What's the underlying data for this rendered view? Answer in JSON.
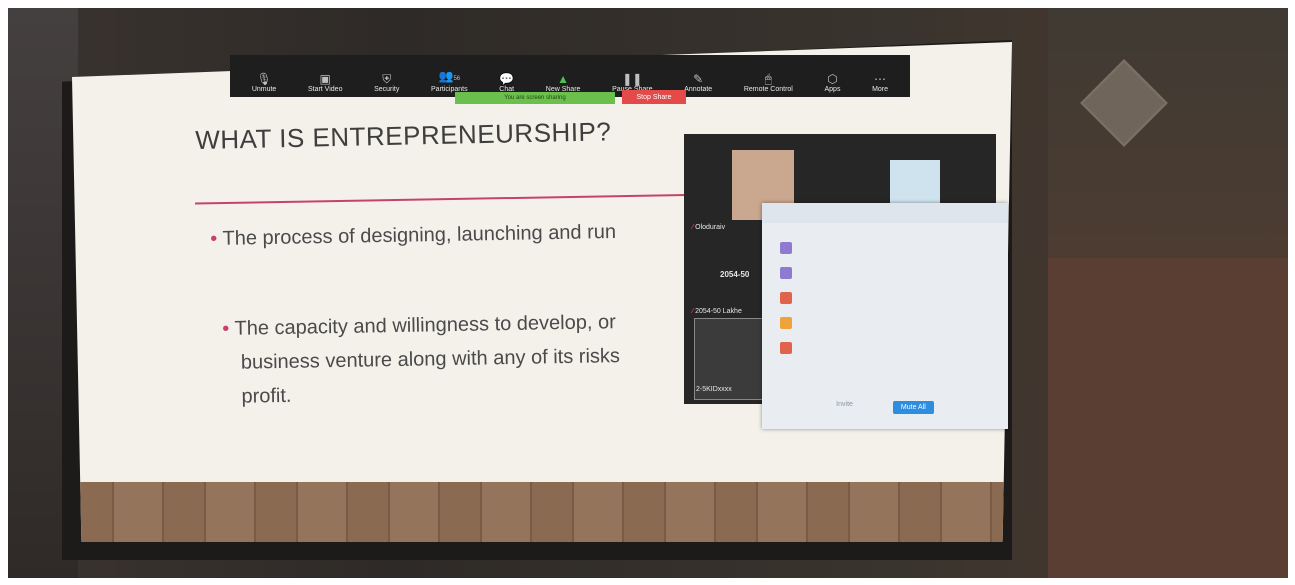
{
  "toolbar": {
    "items": [
      {
        "label": "Unmute",
        "icon": "microphone-icon"
      },
      {
        "label": "Start Video",
        "icon": "video-camera-icon"
      },
      {
        "label": "Security",
        "icon": "shield-icon"
      },
      {
        "label": "Participants",
        "icon": "people-icon",
        "count": "56"
      },
      {
        "label": "Chat",
        "icon": "chat-icon"
      },
      {
        "label": "New Share",
        "icon": "share-screen-icon"
      },
      {
        "label": "Pause Share",
        "icon": "pause-icon"
      },
      {
        "label": "Annotate",
        "icon": "pencil-icon"
      },
      {
        "label": "Remote Control",
        "icon": "mouse-icon"
      },
      {
        "label": "Apps",
        "icon": "apps-icon"
      },
      {
        "label": "More",
        "icon": "ellipsis-icon"
      }
    ],
    "share_notice": "You are screen sharing",
    "stop_share": "Stop Share"
  },
  "slide": {
    "title": "WHAT IS ENTREPRENEURSHIP?",
    "bullet1": "The process of designing, launching and run",
    "bullet2_line1": "The capacity and willingness to develop, or",
    "bullet2_line2": "business venture along with any of its risks",
    "bullet2_line3": "profit."
  },
  "video": {
    "name1": "Oloduraiv",
    "id1": "2054-50",
    "name2": "2054-50 Lakhe",
    "name3": "2-5KIDxxxx"
  },
  "popup": {
    "buttons": [
      "Invite",
      "Mute All"
    ]
  },
  "colors": {
    "accent_pink": "#c7426a",
    "stop_red": "#e44a4a",
    "share_green": "#6bbf4d",
    "popup_button_blue": "#2d8de0"
  }
}
